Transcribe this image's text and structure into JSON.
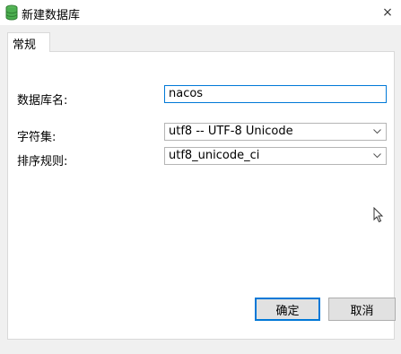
{
  "window": {
    "title": "新建数据库",
    "app_icon": "database-icon",
    "close_label": "×"
  },
  "tabs": [
    {
      "label": "常规",
      "active": true
    }
  ],
  "form": {
    "db_name_label": "数据库名:",
    "db_name_value": "nacos",
    "charset_label": "字符集:",
    "charset_value": "utf8 -- UTF-8 Unicode",
    "collation_label": "排序规则:",
    "collation_value": "utf8_unicode_ci"
  },
  "buttons": {
    "ok_label": "确定",
    "cancel_label": "取消"
  },
  "colors": {
    "focus_border": "#0078d7",
    "db_icon": "#4caf50"
  }
}
